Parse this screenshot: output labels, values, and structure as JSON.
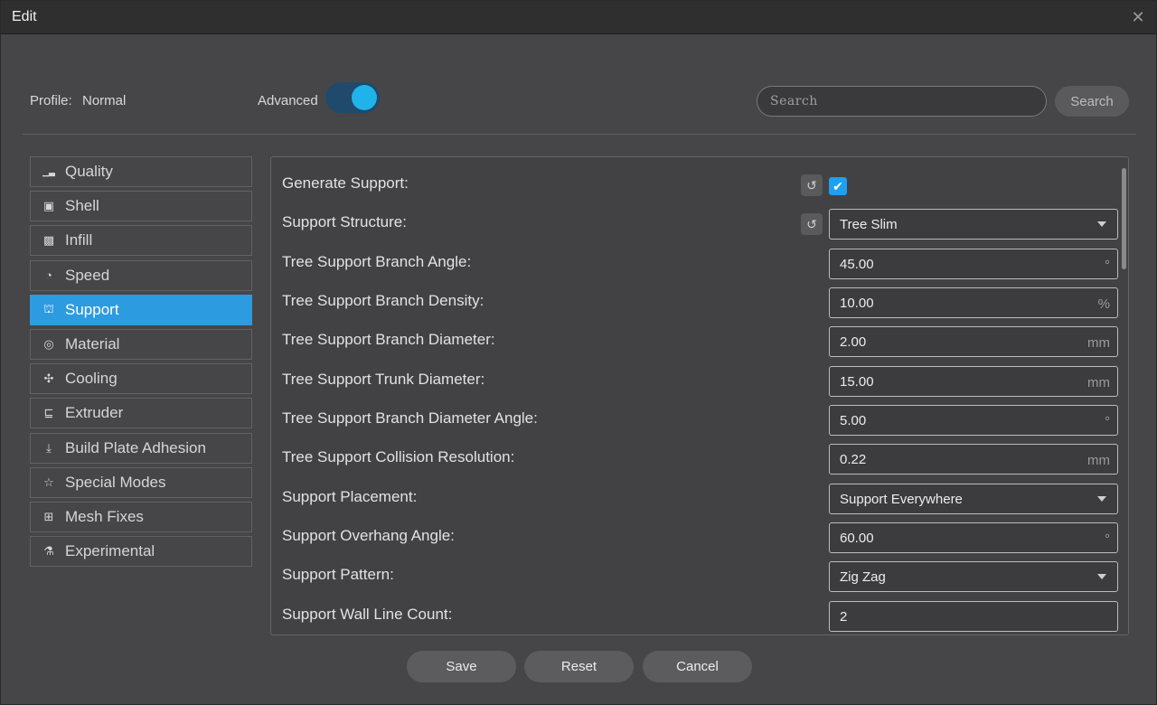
{
  "window": {
    "title": "Edit"
  },
  "header": {
    "profile_label": "Profile:",
    "profile_value": "Normal",
    "advanced_label": "Advanced",
    "advanced_on": true,
    "search_placeholder": "Search",
    "search_button": "Search"
  },
  "sidebar": {
    "items": [
      {
        "label": "Quality",
        "icon": "quality-icon",
        "active": false
      },
      {
        "label": "Shell",
        "icon": "shell-icon",
        "active": false
      },
      {
        "label": "Infill",
        "icon": "infill-icon",
        "active": false
      },
      {
        "label": "Speed",
        "icon": "speed-icon",
        "active": false
      },
      {
        "label": "Support",
        "icon": "support-icon",
        "active": true
      },
      {
        "label": "Material",
        "icon": "material-icon",
        "active": false
      },
      {
        "label": "Cooling",
        "icon": "cooling-icon",
        "active": false
      },
      {
        "label": "Extruder",
        "icon": "extruder-icon",
        "active": false
      },
      {
        "label": "Build Plate Adhesion",
        "icon": "build-plate-icon",
        "active": false
      },
      {
        "label": "Special Modes",
        "icon": "special-modes-icon",
        "active": false
      },
      {
        "label": "Mesh Fixes",
        "icon": "mesh-fixes-icon",
        "active": false
      },
      {
        "label": "Experimental",
        "icon": "experimental-icon",
        "active": false
      }
    ]
  },
  "settings": [
    {
      "label": "Generate Support:",
      "type": "checkbox",
      "checked": true,
      "resettable": true
    },
    {
      "label": "Support Structure:",
      "type": "select",
      "value": "Tree Slim",
      "resettable": true
    },
    {
      "label": "Tree Support Branch Angle:",
      "type": "number",
      "value": "45.00",
      "unit": "°"
    },
    {
      "label": "Tree Support Branch Density:",
      "type": "number",
      "value": "10.00",
      "unit": "%"
    },
    {
      "label": "Tree Support Branch Diameter:",
      "type": "number",
      "value": "2.00",
      "unit": "mm"
    },
    {
      "label": "Tree Support Trunk Diameter:",
      "type": "number",
      "value": "15.00",
      "unit": "mm"
    },
    {
      "label": "Tree Support Branch Diameter Angle:",
      "type": "number",
      "value": "5.00",
      "unit": "°"
    },
    {
      "label": "Tree Support Collision Resolution:",
      "type": "number",
      "value": "0.22",
      "unit": "mm"
    },
    {
      "label": "Support Placement:",
      "type": "select",
      "value": "Support Everywhere"
    },
    {
      "label": "Support Overhang Angle:",
      "type": "number",
      "value": "60.00",
      "unit": "°"
    },
    {
      "label": "Support Pattern:",
      "type": "select",
      "value": "Zig Zag"
    },
    {
      "label": "Support Wall Line Count:",
      "type": "number",
      "value": "2",
      "unit": ""
    }
  ],
  "footer": {
    "save": "Save",
    "reset": "Reset",
    "cancel": "Cancel"
  },
  "colors": {
    "accent": "#2d9be0",
    "toggle_knob": "#21b2ea",
    "window_bg": "#464648",
    "titlebar_bg": "#2f2f30"
  }
}
